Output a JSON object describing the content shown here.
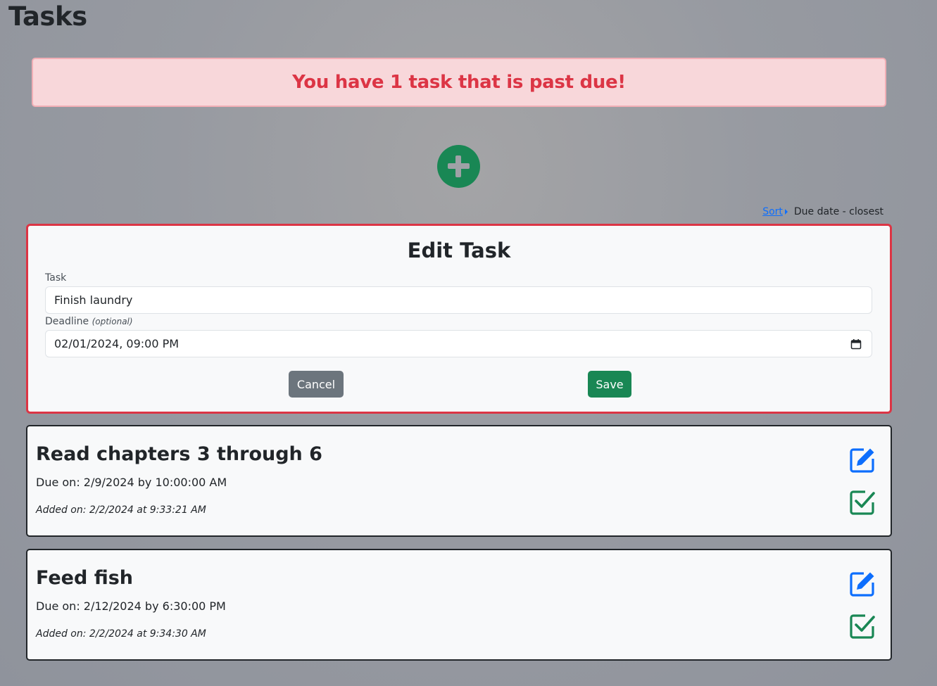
{
  "page": {
    "title": "Tasks"
  },
  "alert": {
    "message": "You have 1 task that is past due!"
  },
  "sort": {
    "link_label": "Sort",
    "value": "Due date - closest"
  },
  "edit_form": {
    "heading": "Edit Task",
    "task_label": "Task",
    "task_value": "Finish laundry",
    "deadline_label": "Deadline",
    "deadline_hint": "(optional)",
    "deadline_value": "02/01/2024, 09:00 PM",
    "cancel_label": "Cancel",
    "save_label": "Save"
  },
  "tasks": [
    {
      "title": "Read chapters 3 through 6",
      "due": "Due on: 2/9/2024 by 10:00:00 AM",
      "added": "Added on: 2/2/2024 at 9:33:21 AM"
    },
    {
      "title": "Feed fish",
      "due": "Due on: 2/12/2024 by 6:30:00 PM",
      "added": "Added on: 2/2/2024 at 9:34:30 AM"
    }
  ],
  "icons": {
    "add": "plus-circle-icon",
    "edit": "pencil-square-icon",
    "complete": "check-square-icon",
    "calendar": "calendar-icon"
  },
  "colors": {
    "danger": "#dc3545",
    "success": "#198754",
    "primary": "#0d6efd",
    "secondary": "#6c757d"
  }
}
